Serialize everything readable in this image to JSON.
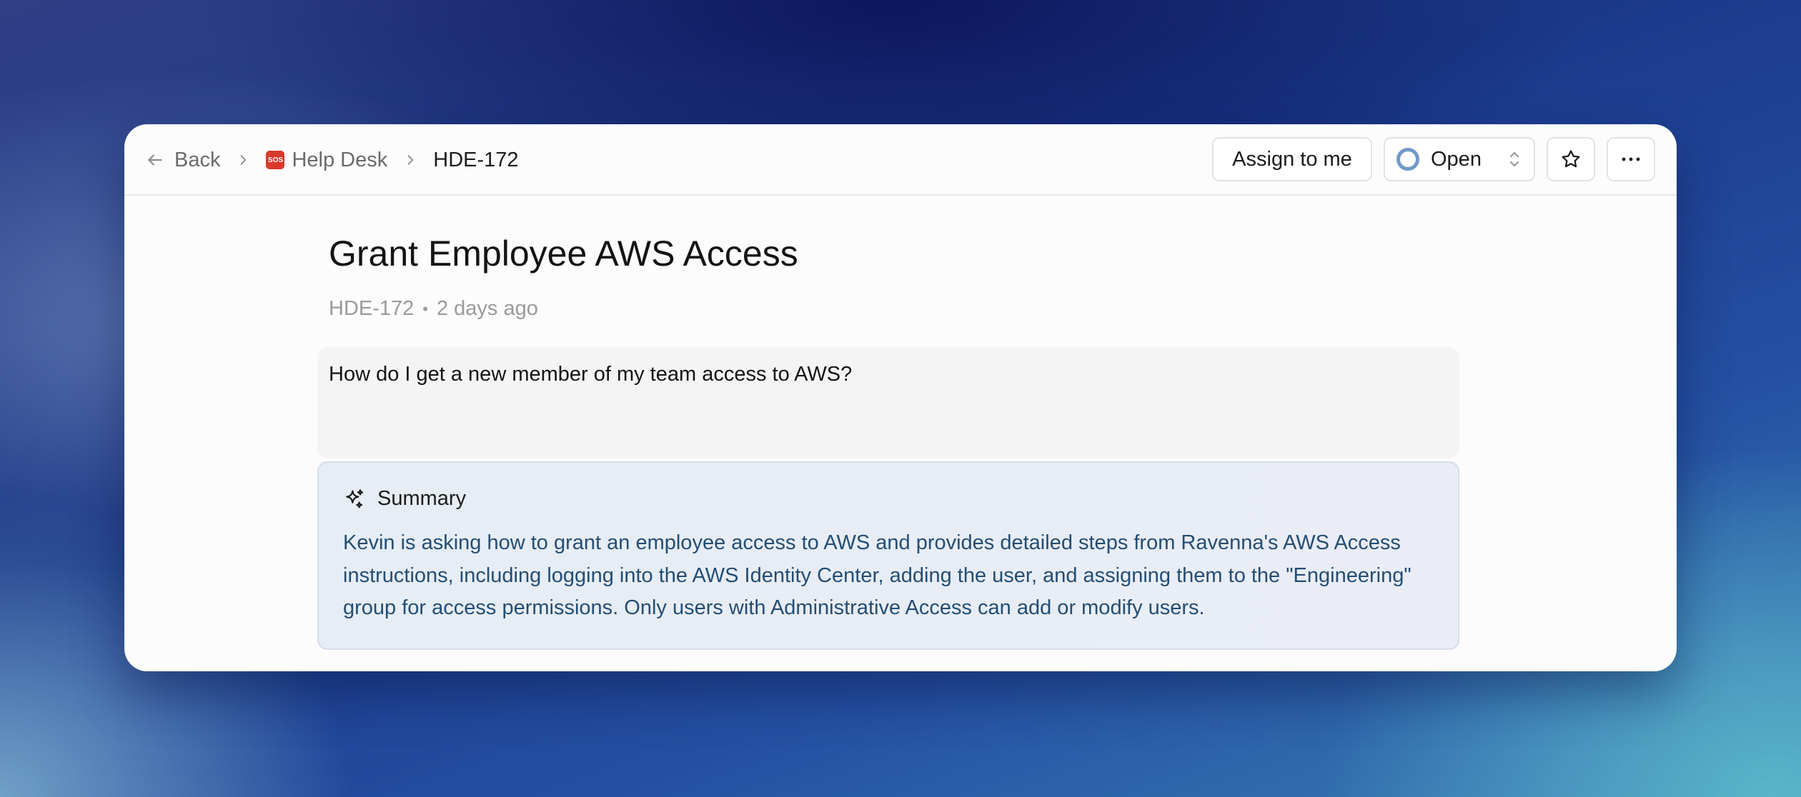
{
  "breadcrumb": {
    "back_label": "Back",
    "desk_label": "Help Desk",
    "desk_icon_text": "SOS",
    "current_label": "HDE-172"
  },
  "toolbar": {
    "assign_label": "Assign to me",
    "status_label": "Open",
    "status_color": "#6f9ac8"
  },
  "ticket": {
    "title": "Grant Employee AWS Access",
    "id": "HDE-172",
    "separator": "•",
    "age": "2 days ago",
    "message": "How do I get a new member of my team access to AWS?"
  },
  "summary": {
    "heading": "Summary",
    "text": "Kevin is asking how to grant an employee access to AWS and provides detailed steps from Ravenna's AWS Access instructions, including logging into the AWS Identity Center, adding the user, and assigning them to the \"Engineering\" group for access permissions. Only users with Administrative Access can add or modify users."
  },
  "icons": {
    "back": "arrow-left-icon",
    "separator": "chevron-right-icon",
    "desk": "sos-icon",
    "status": "status-ring-icon",
    "status_toggle": "chevron-up-down-icon",
    "favorite": "star-icon",
    "more": "more-horizontal-icon",
    "summary": "sparkles-icon"
  }
}
